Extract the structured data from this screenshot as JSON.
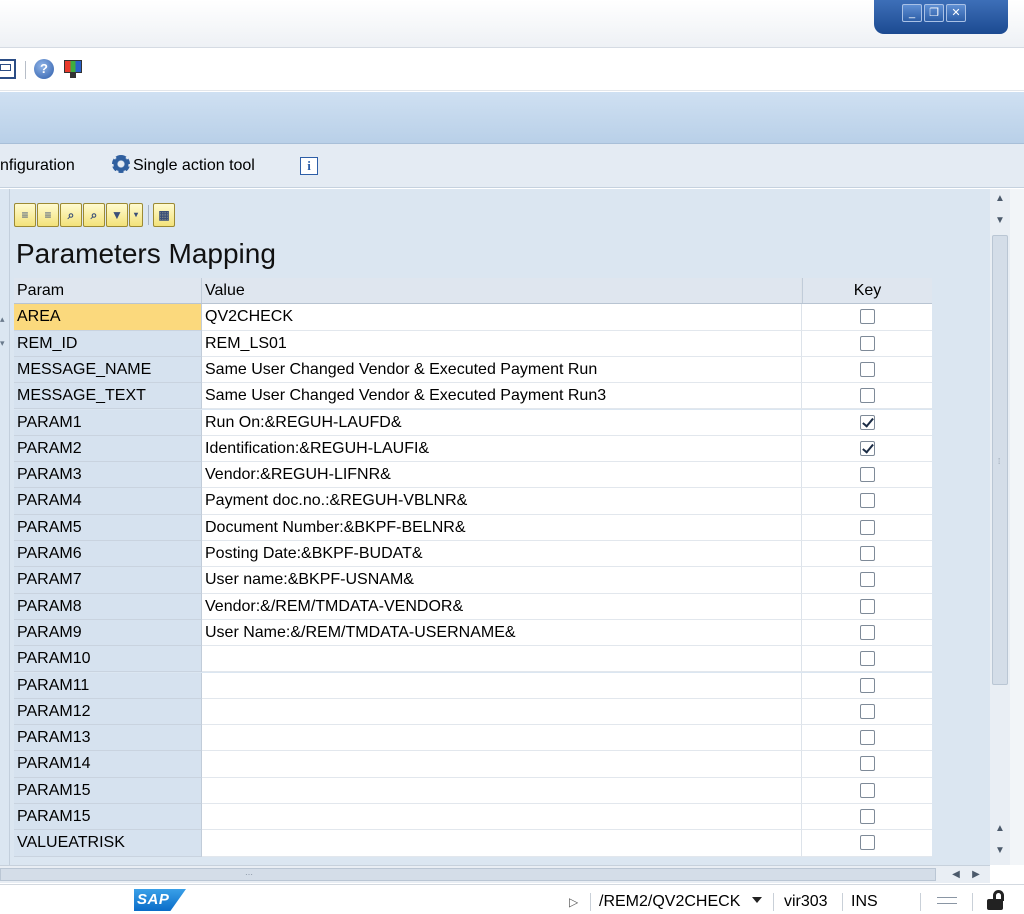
{
  "window": {
    "controls": {
      "minimize": "_",
      "restore": "❐",
      "close": "✕"
    }
  },
  "toolbar": {
    "help_icon_glyph": "?"
  },
  "app_toolbar": {
    "config_label": "nfiguration",
    "single_action_label": "Single action tool",
    "info_glyph": "i"
  },
  "grid": {
    "title": "Parameters Mapping",
    "columns": {
      "param": "Param",
      "value": "Value",
      "key": "Key"
    },
    "rows": [
      {
        "param": "AREA",
        "value": "QV2CHECK",
        "key": false,
        "selected": true
      },
      {
        "param": "REM_ID",
        "value": "REM_LS01",
        "key": false
      },
      {
        "param": "MESSAGE_NAME",
        "value": "Same User Changed Vendor  & Executed Payment Run",
        "key": false
      },
      {
        "param": "MESSAGE_TEXT",
        "value": "Same User Changed Vendor  & Executed Payment Run3",
        "key": false
      },
      {
        "param": "PARAM1",
        "value": "Run On:&REGUH-LAUFD&",
        "key": true
      },
      {
        "param": "PARAM2",
        "value": "Identification:&REGUH-LAUFI&",
        "key": true
      },
      {
        "param": "PARAM3",
        "value": "Vendor:&REGUH-LIFNR&",
        "key": false
      },
      {
        "param": "PARAM4",
        "value": "Payment doc.no.:&REGUH-VBLNR&",
        "key": false
      },
      {
        "param": "PARAM5",
        "value": "Document Number:&BKPF-BELNR&",
        "key": false
      },
      {
        "param": "PARAM6",
        "value": "Posting Date:&BKPF-BUDAT&",
        "key": false
      },
      {
        "param": "PARAM7",
        "value": "User name:&BKPF-USNAM&",
        "key": false
      },
      {
        "param": "PARAM8",
        "value": "Vendor:&/REM/TMDATA-VENDOR&",
        "key": false
      },
      {
        "param": "PARAM9",
        "value": "User Name:&/REM/TMDATA-USERNAME&",
        "key": false
      },
      {
        "param": "PARAM10",
        "value": "",
        "key": false
      },
      {
        "param": "PARAM11",
        "value": "",
        "key": false
      },
      {
        "param": "PARAM12",
        "value": "",
        "key": false
      },
      {
        "param": "PARAM13",
        "value": "",
        "key": false
      },
      {
        "param": "PARAM14",
        "value": "",
        "key": false
      },
      {
        "param": "PARAM15",
        "value": "",
        "key": false
      },
      {
        "param": "PARAM15",
        "value": "",
        "key": false
      },
      {
        "param": "VALUEATRISK",
        "value": "",
        "key": false
      }
    ]
  },
  "status_bar": {
    "logo": "SAP",
    "transaction": "/REM2/QV2CHECK",
    "system": "vir303",
    "mode": "INS"
  },
  "colors": {
    "selected_param": "#fbd97d",
    "param_column": "#d6e2ef",
    "header": "#dfe6ef",
    "window_controls": "#2d5ea7"
  }
}
